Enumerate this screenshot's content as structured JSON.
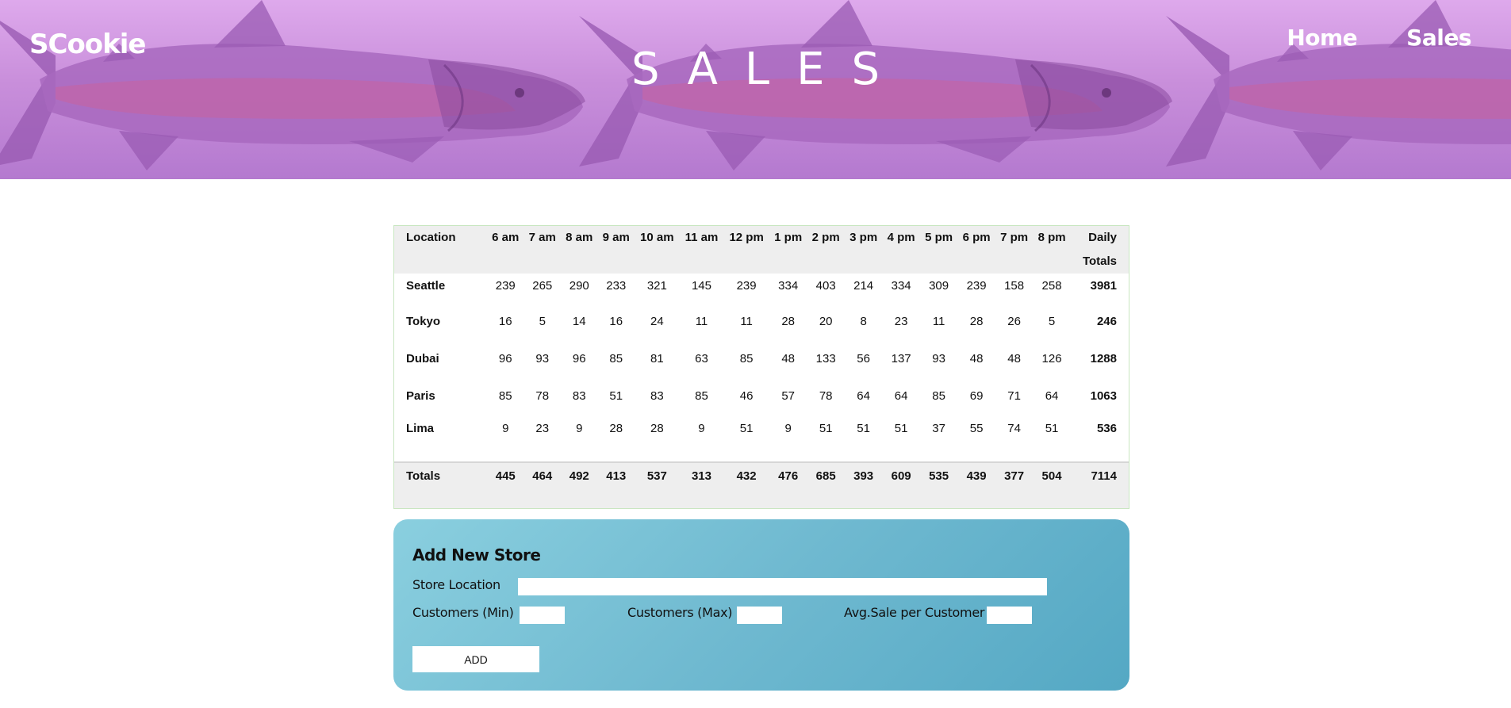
{
  "header": {
    "brand": "SCookie",
    "title": "SALES",
    "nav": [
      {
        "label": "Home"
      },
      {
        "label": "Sales"
      }
    ],
    "banner_icon": "salmon-fish-icon",
    "banner_colors": [
      "#dea9ec",
      "#b479cf"
    ]
  },
  "sales_table": {
    "headers": [
      "Location",
      "6 am",
      "7 am",
      "8 am",
      "9 am",
      "10 am",
      "11 am",
      "12 pm",
      "1 pm",
      "2 pm",
      "3 pm",
      "4 pm",
      "5 pm",
      "6 pm",
      "7 pm",
      "8 pm"
    ],
    "daily_header": [
      "Daily",
      "Totals"
    ],
    "rows": [
      {
        "location": "Seattle",
        "values": [
          "239",
          "265",
          "290",
          "233",
          "321",
          "145",
          "239",
          "334",
          "403",
          "214",
          "334",
          "309",
          "239",
          "158",
          "258"
        ],
        "total": "3981"
      },
      {
        "location": "Tokyo",
        "values": [
          "16",
          "5",
          "14",
          "16",
          "24",
          "11",
          "11",
          "28",
          "20",
          "8",
          "23",
          "11",
          "28",
          "26",
          "5"
        ],
        "total": "246"
      },
      {
        "location": "Dubai",
        "values": [
          "96",
          "93",
          "96",
          "85",
          "81",
          "63",
          "85",
          "48",
          "133",
          "56",
          "137",
          "93",
          "48",
          "48",
          "126"
        ],
        "total": "1288"
      },
      {
        "location": "Paris",
        "values": [
          "85",
          "78",
          "83",
          "51",
          "83",
          "85",
          "46",
          "57",
          "78",
          "64",
          "64",
          "85",
          "69",
          "71",
          "64"
        ],
        "total": "1063"
      },
      {
        "location": "Lima",
        "values": [
          "9",
          "23",
          "9",
          "28",
          "28",
          "9",
          "51",
          "9",
          "51",
          "51",
          "51",
          "37",
          "55",
          "74",
          "51"
        ],
        "total": "536"
      }
    ],
    "totals_row": {
      "label": "Totals",
      "values": [
        "445",
        "464",
        "492",
        "413",
        "537",
        "313",
        "432",
        "476",
        "685",
        "393",
        "609",
        "535",
        "439",
        "377",
        "504"
      ],
      "total": "7114"
    }
  },
  "form": {
    "title": "Add New Store",
    "location_label": "Store Location",
    "location_value": "",
    "min_label": "Customers (Min)",
    "min_value": "",
    "max_label": "Customers (Max)",
    "max_value": "",
    "avg_label": "Avg.Sale per Customer",
    "avg_value": "",
    "submit_label": "ADD",
    "card_colors": [
      "#8acfdf",
      "#54a8c4"
    ]
  }
}
